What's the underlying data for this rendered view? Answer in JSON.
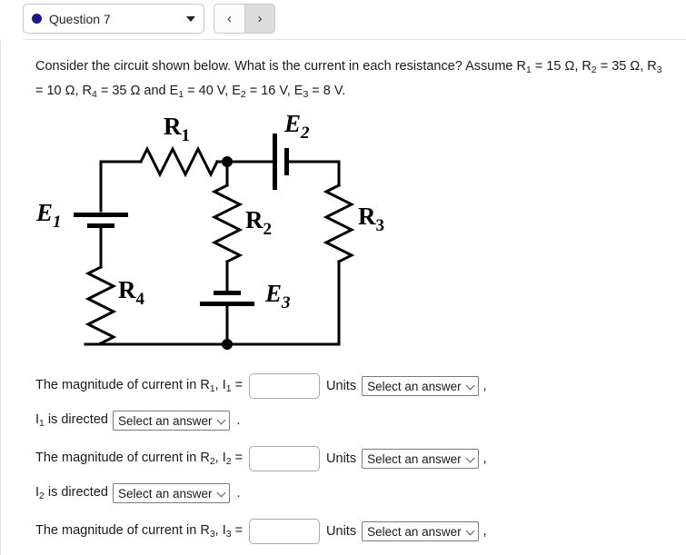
{
  "topbar": {
    "question_label": "Question 7",
    "marker_color": "#1a1a8c",
    "prev_label": "‹",
    "next_label": "›"
  },
  "question": {
    "line1_a": "Consider the circuit shown below. What is the current in each resistance? Assume R",
    "line1_b": " = 15 Ω, R",
    "line1_c": " = 35 Ω,",
    "line2_a": "R",
    "line2_b": " = 10 Ω, R",
    "line2_c": " = 35 Ω and E",
    "line2_d": " = 40 V, E",
    "line2_e": " = 16 V, E",
    "line2_f": " = 8 V.",
    "sub_1": "1",
    "sub_2": "2",
    "sub_3": "3",
    "sub_4": "4",
    "values": {
      "R1": "15 Ω",
      "R2": "35 Ω",
      "R3": "10 Ω",
      "R4": "35 Ω",
      "E1": "40 V",
      "E2": "16 V",
      "E3": "8 V"
    }
  },
  "circuit": {
    "labels": {
      "R1": "R",
      "R1_sub": "1",
      "R2": "R",
      "R2_sub": "2",
      "R3": "R",
      "R3_sub": "3",
      "R4": "R",
      "R4_sub": "4",
      "E1": "E",
      "E1_sub": "1",
      "E2": "E",
      "E2_sub": "2",
      "E3": "E",
      "E3_sub": "3"
    },
    "stroke_color": "#000000"
  },
  "answers": {
    "units_label": "Units",
    "select_placeholder": "Select an answer",
    "comma": ",",
    "period": ".",
    "rows": [
      {
        "prefix": "The magnitude of current in R",
        "sub": "1",
        "mid": ", I",
        "eq": " =",
        "value": "",
        "placeholder": ""
      },
      {
        "prefix": "The magnitude of current in R",
        "sub": "2",
        "mid": ", I",
        "eq": " =",
        "value": "",
        "placeholder": ""
      },
      {
        "prefix": "The magnitude of current in R",
        "sub": "3",
        "mid": ", I",
        "eq": " =",
        "value": "",
        "placeholder": ""
      }
    ],
    "direction_rows": [
      {
        "pre": "I",
        "sub": "1",
        "post": " is directed"
      },
      {
        "pre": "I",
        "sub": "2",
        "post": " is directed"
      }
    ]
  }
}
